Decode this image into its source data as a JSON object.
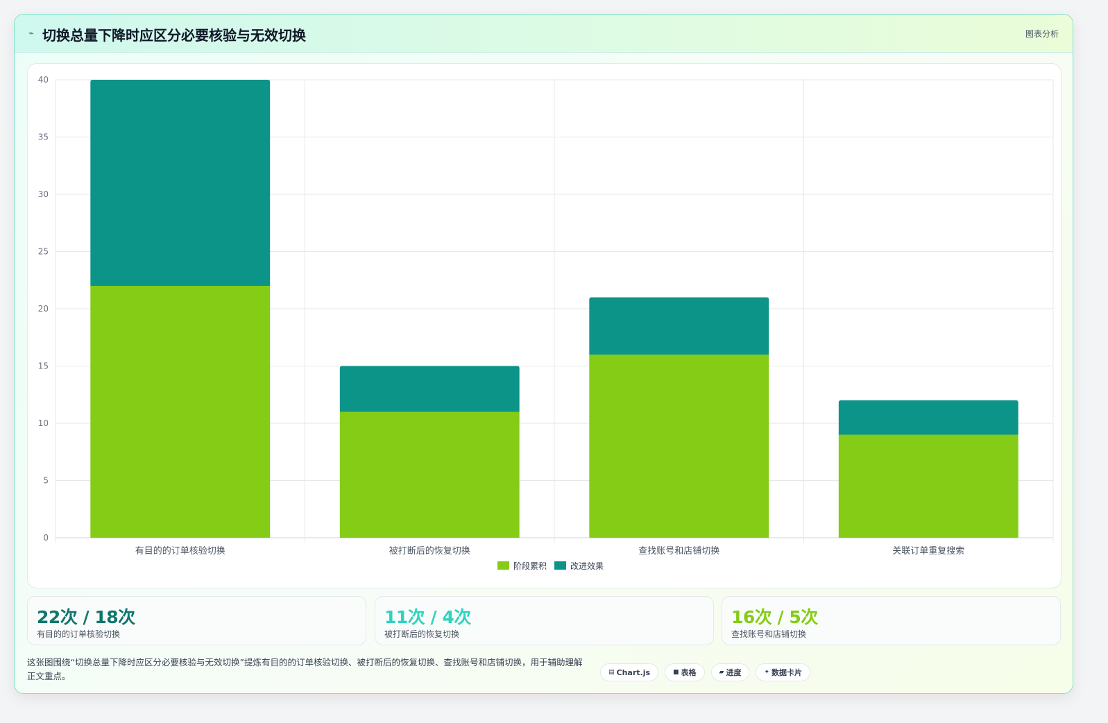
{
  "header": {
    "icon": "chart-spark-icon",
    "title": "切换总量下降时应区分必要核验与无效切换",
    "tag": "图表分析"
  },
  "colors": {
    "stage": "#84cc16",
    "improve": "#0d9488",
    "stat1": "#0f766e",
    "stat2": "#2dd4bf",
    "stat3": "#84cc16"
  },
  "chart_data": {
    "type": "bar",
    "stacked": true,
    "categories": [
      "有目的的订单核验切换",
      "被打断后的恢复切换",
      "查找账号和店铺切换",
      "关联订单重复搜索"
    ],
    "series": [
      {
        "name": "阶段累积",
        "values": [
          22,
          11,
          16,
          9
        ],
        "color": "#84cc16"
      },
      {
        "name": "改进效果",
        "values": [
          18,
          4,
          5,
          3
        ],
        "color": "#0d9488"
      }
    ],
    "ylim": [
      0,
      40
    ],
    "yticks": [
      0,
      5,
      10,
      15,
      20,
      25,
      30,
      35,
      40
    ],
    "grid": true,
    "legend": "bottom",
    "title": "",
    "xlabel": "",
    "ylabel": ""
  },
  "stats": [
    {
      "value": "22次 / 18次",
      "label": "有目的的订单核验切换"
    },
    {
      "value": "11次 / 4次",
      "label": "被打断后的恢复切换"
    },
    {
      "value": "16次 / 5次",
      "label": "查找账号和店铺切换"
    }
  ],
  "footer": {
    "text": "这张图围绕“切换总量下降时应区分必要核验与无效切换”提炼有目的的订单核验切换、被打断后的恢复切换、查找账号和店铺切换，用于辅助理解正文重点。",
    "chips": [
      {
        "icon": "chart-icon",
        "glyph": "▤",
        "label": "Chart.js"
      },
      {
        "icon": "table-icon",
        "glyph": "■",
        "label": "表格"
      },
      {
        "icon": "progress-icon",
        "glyph": "▰",
        "label": "进度"
      },
      {
        "icon": "sparkle-icon",
        "glyph": "✦",
        "label": "数据卡片"
      }
    ]
  }
}
